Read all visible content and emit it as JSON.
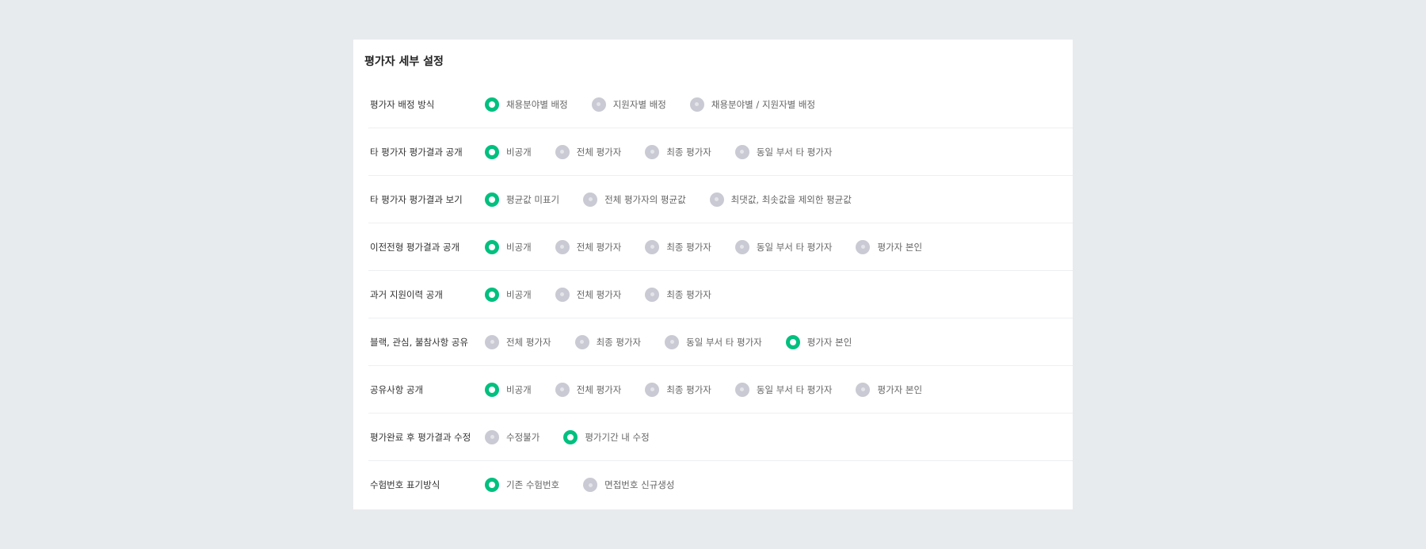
{
  "title": "평가자 세부 설정",
  "colors": {
    "selected": "#00c07f",
    "unselected": "#c9cad3"
  },
  "rows": [
    {
      "label": "평가자 배정 방식",
      "options": [
        "채용분야별 배정",
        "지원자별 배정",
        "채용분야별 / 지원자별 배정"
      ],
      "selected": 0
    },
    {
      "label": "타 평가자 평가결과 공개",
      "options": [
        "비공개",
        "전체 평가자",
        "최종 평가자",
        "동일 부서 타 평가자"
      ],
      "selected": 0
    },
    {
      "label": "타 평가자 평가결과 보기",
      "options": [
        "평균값 미표기",
        "전체 평가자의 평균값",
        "최댓값, 최솟값을 제외한 평균값"
      ],
      "selected": 0
    },
    {
      "label": "이전전형 평가결과 공개",
      "options": [
        "비공개",
        "전체 평가자",
        "최종 평가자",
        "동일 부서 타 평가자",
        "평가자 본인"
      ],
      "selected": 0
    },
    {
      "label": "과거 지원이력 공개",
      "options": [
        "비공개",
        "전체 평가자",
        "최종 평가자"
      ],
      "selected": 0
    },
    {
      "label": "블랙, 관심, 불참사항 공유",
      "options": [
        "전체 평가자",
        "최종 평가자",
        "동일 부서 타 평가자",
        "평가자 본인"
      ],
      "selected": 3
    },
    {
      "label": "공유사항 공개",
      "options": [
        "비공개",
        "전체 평가자",
        "최종 평가자",
        "동일 부서 타 평가자",
        "평가자 본인"
      ],
      "selected": 0
    },
    {
      "label": "평가완료 후 평가결과 수정",
      "options": [
        "수정불가",
        "평가기간 내 수정"
      ],
      "selected": 1
    },
    {
      "label": "수험번호 표기방식",
      "options": [
        "기존 수험번호",
        "면접번호 신규생성"
      ],
      "selected": 0
    }
  ]
}
